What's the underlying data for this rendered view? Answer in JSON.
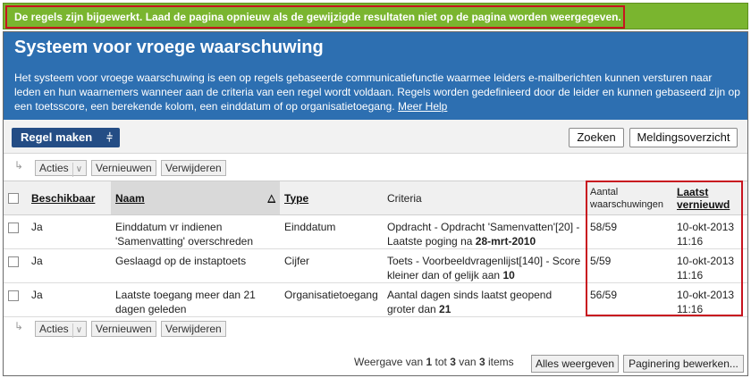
{
  "notice": {
    "text": "De regels zijn bijgewerkt. Laad de pagina opnieuw als de gewijzigde resultaten niet op de pagina worden weergegeven."
  },
  "header": {
    "title": "Systeem voor vroege waarschuwing",
    "intro": "Het systeem voor vroege waarschuwing is een op regels gebaseerde communicatiefunctie waarmee leiders e-mailberichten kunnen versturen naar leden en hun waarnemers wanneer aan de criteria van een regel wordt voldaan. Regels worden gedefinieerd door de leider en kunnen gebaseerd zijn op een toetsscore, een berekende kolom, een einddatum of op organisatietoegang.",
    "help_link": "Meer Help"
  },
  "toolbar": {
    "create_rule": "Regel maken",
    "search": "Zoeken",
    "notification_overview": "Meldingsoverzicht"
  },
  "actions": {
    "acties": "Acties",
    "refresh": "Vernieuwen",
    "delete": "Verwijderen"
  },
  "table": {
    "headers": {
      "available": "Beschikbaar",
      "name": "Naam",
      "type": "Type",
      "criteria": "Criteria",
      "warnings_line1": "Aantal",
      "warnings_line2": "waarschuwingen",
      "last_line1": "Laatst",
      "last_line2": "vernieuwd"
    },
    "rows": [
      {
        "available": "Ja",
        "name": "Einddatum vr indienen 'Samenvatting' overschreden",
        "type": "Einddatum",
        "criteria": "Opdracht - Opdracht 'Samenvatten'[20] - Laatste poging na",
        "criteria_bold": "28-mrt-2010",
        "warnings": "58/59",
        "last_date": "10-okt-2013",
        "last_time": "11:16"
      },
      {
        "available": "Ja",
        "name": "Geslaagd op de instaptoets",
        "type": "Cijfer",
        "criteria": "Toets - Voorbeeldvragenlijst[140] - Score kleiner dan of gelijk aan",
        "criteria_bold": "10",
        "warnings": "5/59",
        "last_date": "10-okt-2013",
        "last_time": "11:16"
      },
      {
        "available": "Ja",
        "name": "Laatste toegang meer dan 21 dagen geleden",
        "type": "Organisatietoegang",
        "criteria": "Aantal dagen sinds laatst geopend groter dan",
        "criteria_bold": "21",
        "warnings": "56/59",
        "last_date": "10-okt-2013",
        "last_time": "11:16"
      }
    ]
  },
  "footer": {
    "showing_prefix": "Weergave van",
    "from": "1",
    "to_word": "tot",
    "to": "3",
    "of_word": "van",
    "total": "3",
    "items_word": "items",
    "show_all": "Alles weergeven",
    "edit_paging": "Paginering bewerken..."
  },
  "colors": {
    "notice_bg": "#7ab52f",
    "header_bg": "#2d6fb1",
    "primary_button": "#244d85",
    "highlight": "#c8141f"
  }
}
